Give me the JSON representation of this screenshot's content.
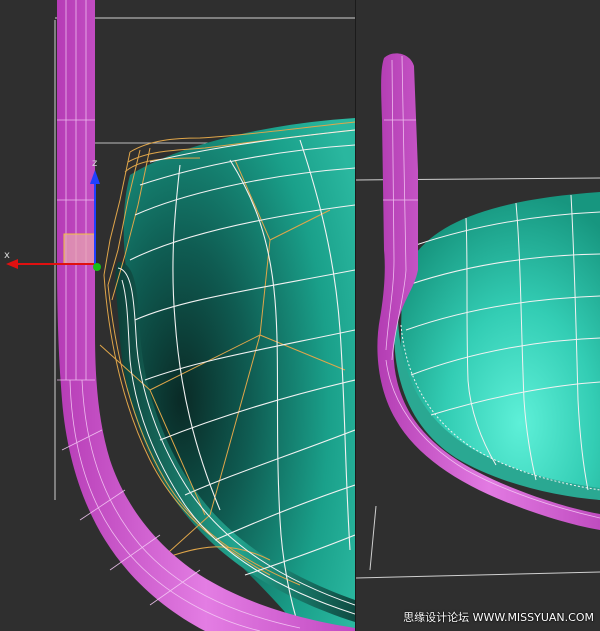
{
  "viewports": {
    "left": {
      "gizmo": {
        "x_label": "x",
        "z_label": "z"
      }
    },
    "right": {}
  },
  "colors": {
    "background": "#2f2f2f",
    "mesh_teal": "#1fa58f",
    "mesh_highlight": "#5ee6cf",
    "handle_magenta": "#d25ad2",
    "wire_white": "#f2f2f2",
    "wire_orange": "#e0a64a",
    "axis_x": "#e01010",
    "axis_y": "#16c016",
    "axis_z": "#2040ff",
    "plane_handle": "#e7a3b0"
  },
  "icons": [
    "move-gizmo-icon",
    "x-axis-arrow-icon",
    "z-axis-arrow-icon",
    "y-axis-dot-icon",
    "xy-plane-handle-icon"
  ],
  "watermark": {
    "text": "思缘设计论坛  WWW.MISSYUAN.COM"
  }
}
